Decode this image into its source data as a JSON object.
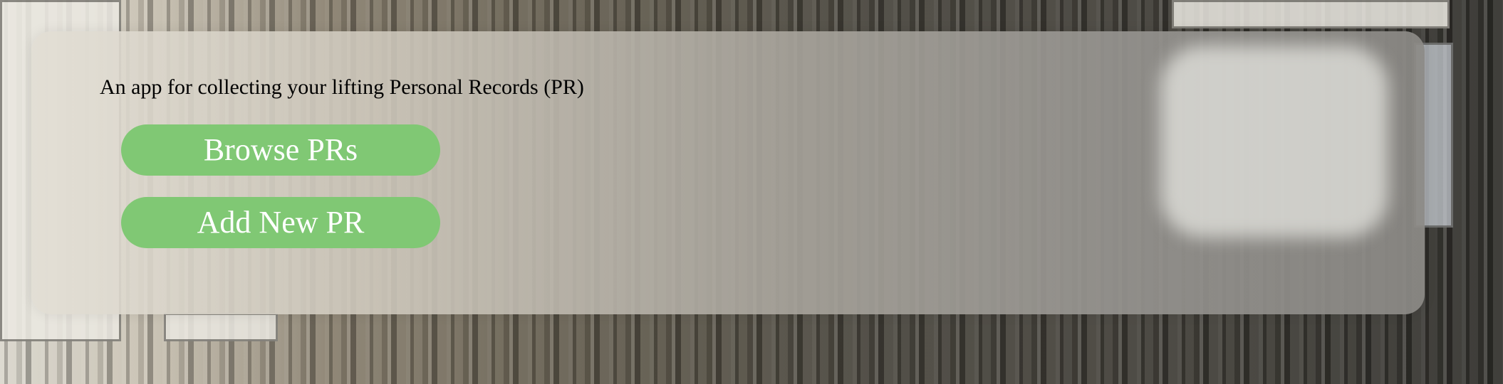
{
  "app": {
    "tagline": "An app for collecting your lifting Personal Records (PR)"
  },
  "actions": {
    "browse_label": "Browse PRs",
    "add_label": "Add New PR"
  },
  "colors": {
    "button_background": "#80c874",
    "button_text": "#ffffff",
    "tagline_text": "#000000"
  }
}
